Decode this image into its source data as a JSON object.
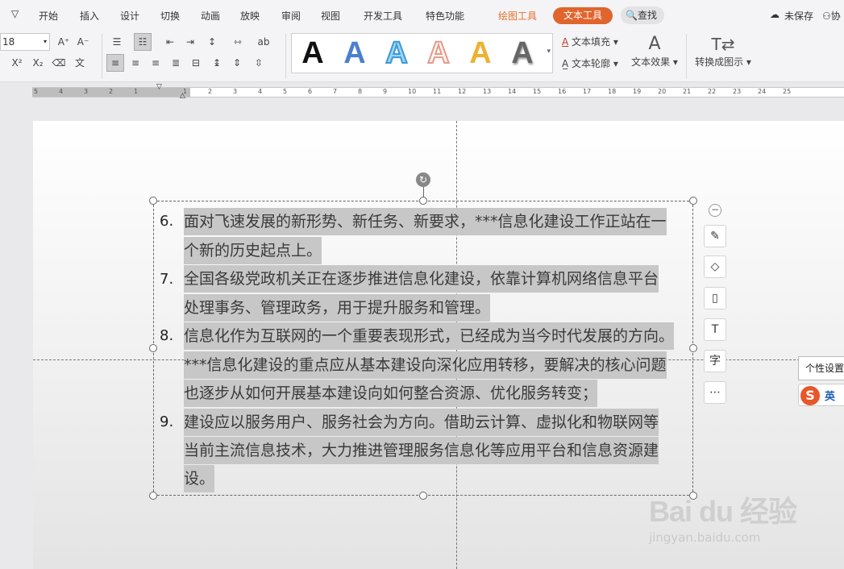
{
  "menubar": {
    "dropdown_icon": "chevron-down-icon",
    "tabs": [
      "开始",
      "插入",
      "设计",
      "切换",
      "动画",
      "放映",
      "审阅",
      "视图",
      "开发工具",
      "特色功能"
    ],
    "drawing_tools": "绘图工具",
    "text_tools": "文本工具",
    "search": "查找",
    "unsaved": "未保存",
    "collab": "协"
  },
  "toolbar": {
    "font_size": "18",
    "text_fill": "文本填充",
    "text_outline": "文本轮廓",
    "text_effect": "文本效果",
    "convert_to_diagram": "转换成图示",
    "art_colors": [
      "#111111",
      "#4a7fd0",
      "#5aaee0",
      "#e8a89a",
      "#f0b030",
      "#666666"
    ],
    "art_letter": "A"
  },
  "ruler": {
    "numbers": [
      "5",
      "4",
      "3",
      "2",
      "1",
      "1",
      "2",
      "3",
      "4",
      "5",
      "6",
      "7",
      "8",
      "9",
      "10",
      "11",
      "12",
      "13",
      "14",
      "15",
      "16",
      "17",
      "18",
      "19",
      "20",
      "21",
      "22",
      "23",
      "24",
      "25"
    ]
  },
  "document": {
    "items": [
      {
        "num": "6.",
        "lines": [
          "面对飞速发展的新形势、新任务、新要求，***信息化建设工作正站在一",
          "个新的历史起点上。"
        ]
      },
      {
        "num": "7.",
        "lines": [
          "全国各级党政机关正在逐步推进信息化建设，依靠计算机网络信息平台",
          "处理事务、管理政务，用于提升服务和管理。"
        ]
      },
      {
        "num": "8.",
        "lines": [
          "信息化作为互联网的一个重要表现形式，已经成为当今时代发展的方向。",
          "***信息化建设的重点应从基本建设向深化应用转移，要解决的核心问题",
          "也逐步从如何开展基本建设向如何整合资源、优化服务转变；"
        ]
      },
      {
        "num": "9.",
        "lines": [
          "建设应以服务用户、服务社会为方向。借助云计算、虚拟化和物联网等",
          "当前主流信息技术，大力推进管理服务信息化等应用平台和信息资源建",
          "设。"
        ]
      }
    ]
  },
  "side_tools": {
    "icons": [
      "pencil-icon",
      "fill-bucket-icon",
      "outline-icon",
      "text-box-icon",
      "character-icon",
      "more-icon"
    ]
  },
  "tooltip": {
    "text": "个性设置"
  },
  "ime": {
    "logo": "S",
    "mode": "英"
  },
  "watermark": {
    "logo": "Bai du 经验",
    "url": "jingyan.baidu.com"
  }
}
